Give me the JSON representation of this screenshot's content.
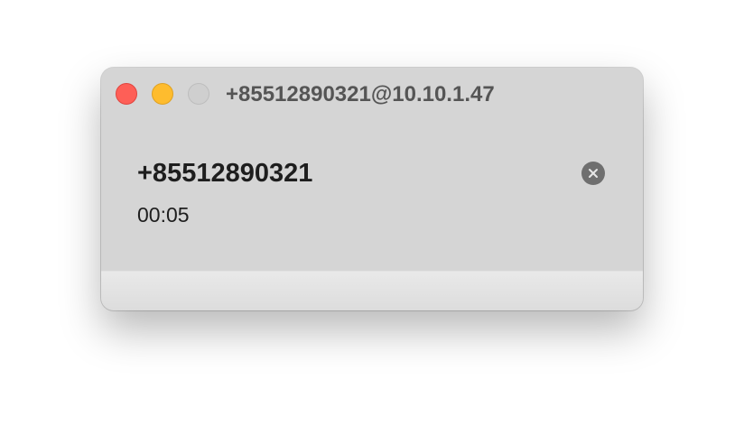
{
  "window": {
    "title": "+85512890321@10.10.1.47",
    "controls": {
      "close_color": "#fe5f57",
      "minimize_color": "#febc2e",
      "zoom_color": "#cfcfcf"
    }
  },
  "call": {
    "number": "+85512890321",
    "duration": "00:05",
    "end_call_icon": "close-circle-icon"
  }
}
